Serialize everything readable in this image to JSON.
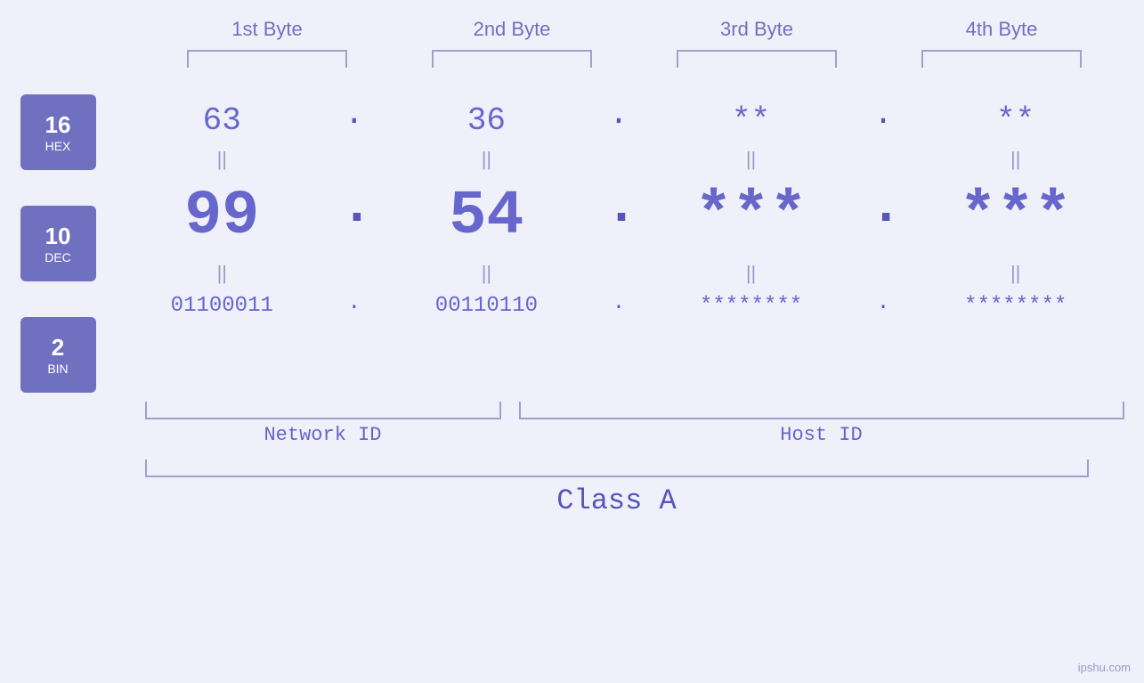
{
  "header": {
    "bytes": [
      {
        "label": "1st Byte"
      },
      {
        "label": "2nd Byte"
      },
      {
        "label": "3rd Byte"
      },
      {
        "label": "4th Byte"
      }
    ]
  },
  "bases": [
    {
      "number": "16",
      "name": "HEX"
    },
    {
      "number": "10",
      "name": "DEC"
    },
    {
      "number": "2",
      "name": "BIN"
    }
  ],
  "values": {
    "hex": [
      "63",
      "36",
      "**",
      "**"
    ],
    "dec": [
      "99",
      "54",
      "***",
      "***"
    ],
    "bin": [
      "01100011",
      "00110110",
      "********",
      "********"
    ]
  },
  "labels": {
    "network_id": "Network ID",
    "host_id": "Host ID",
    "class": "Class A"
  },
  "watermark": "ipshu.com"
}
